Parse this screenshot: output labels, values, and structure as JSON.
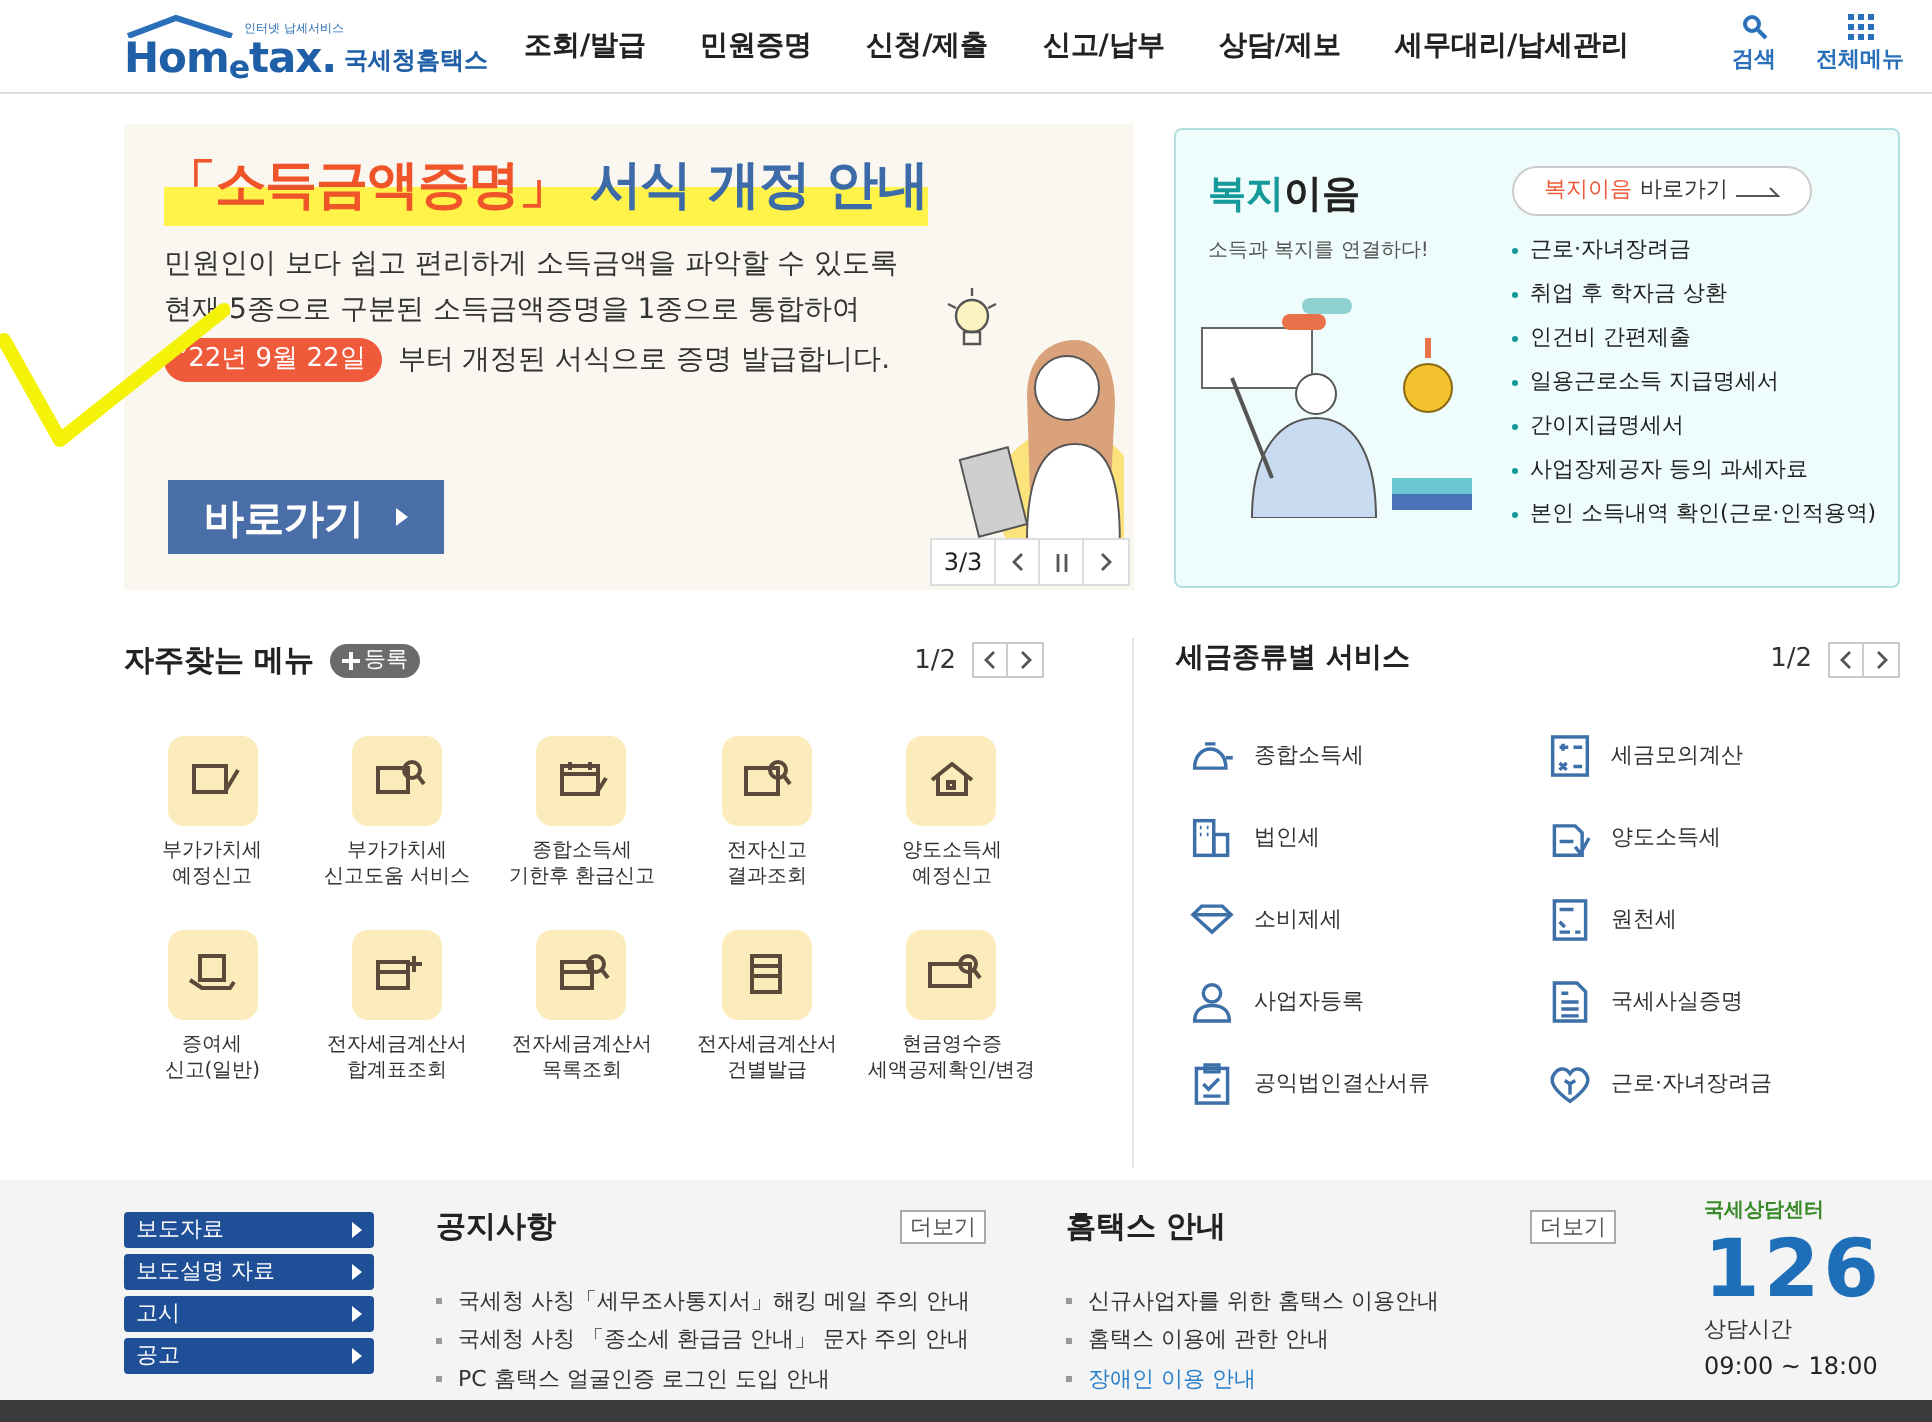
{
  "header": {
    "logo": {
      "tagline": "인터넷 납세서비스",
      "wordmark": "Hom$_{e}$tax.",
      "name": "국세청홈택스"
    },
    "nav": [
      {
        "label": "조회/발급"
      },
      {
        "label": "민원증명"
      },
      {
        "label": "신청/제출"
      },
      {
        "label": "신고/납부"
      },
      {
        "label": "상담/제보"
      },
      {
        "label": "세무대리/납세관리"
      }
    ],
    "utilities": [
      {
        "label": "검색",
        "kind": "search"
      },
      {
        "label": "전체메뉴",
        "kind": "menu"
      }
    ]
  },
  "banner": {
    "title_highlight": "「소득금액증명」",
    "title_rest": "서식 개정 안내",
    "lines": [
      "민원인이 보다 쉽고 편리하게 소득금액을 파악할 수 있도록",
      "현재 5종으로 구분된 소득금액증명을 1종으로 통합하여"
    ],
    "date_badge": "’22년 9월 22일",
    "line_rest": "부터 개정된 서식으로 증명 발급합니다.",
    "button": "바로가기",
    "pager": "3/3"
  },
  "welfare": {
    "title_a": "복지",
    "title_b": "이음",
    "subtitle": "소득과 복지를 연결하다!",
    "link_highlight": "복지이음",
    "link_rest": "바로가기",
    "items": [
      "근로·자녀장려금",
      "취업 후 학자금 상환",
      "인건비 간편제출",
      "일용근로소득 지급명세서",
      "간이지급명세서",
      "사업장제공자 등의 과세자료",
      "본인 소득내역 확인(근로·인적용역)"
    ]
  },
  "favorites": {
    "title": "자주찾는 메뉴",
    "add_button": "등록",
    "pager": "1/2",
    "items": [
      {
        "lines": [
          "부가가치세",
          "예정신고"
        ]
      },
      {
        "lines": [
          "부가가치세",
          "신고도움 서비스"
        ]
      },
      {
        "lines": [
          "종합소득세",
          "기한후 환급신고"
        ]
      },
      {
        "lines": [
          "전자신고",
          "결과조회"
        ]
      },
      {
        "lines": [
          "양도소득세",
          "예정신고"
        ]
      },
      {
        "lines": [
          "증여세",
          "신고(일반)"
        ]
      },
      {
        "lines": [
          "전자세금계산서",
          "합계표조회"
        ]
      },
      {
        "lines": [
          "전자세금계산서",
          "목록조회"
        ]
      },
      {
        "lines": [
          "전자세금계산서",
          "건별발급"
        ]
      },
      {
        "lines": [
          "현금영수증",
          "세액공제확인/변경"
        ]
      }
    ]
  },
  "tax_services": {
    "title": "세금종류별 서비스",
    "pager": "1/2",
    "items": [
      "종합소득세",
      "세금모의계산",
      "법인세",
      "양도소득세",
      "소비제세",
      "원천세",
      "사업자등록",
      "국세사실증명",
      "공익법인결산서류",
      "근로·자녀장려금"
    ]
  },
  "footer": {
    "side_menu": [
      "보도자료",
      "보도설명 자료",
      "고시",
      "공고"
    ],
    "notices": {
      "title": "공지사항",
      "more": "더보기",
      "items": [
        {
          "text": "국세청 사칭「세무조사통지서」해킹 메일 주의 안내",
          "highlighted": false
        },
        {
          "text": "국세청 사칭 「종소세 환급금 안내」 문자 주의 안내",
          "highlighted": false
        },
        {
          "text": "PC 홈택스 얼굴인증 로그인 도입 안내",
          "highlighted": false
        }
      ]
    },
    "guide": {
      "title": "홈택스 안내",
      "more": "더보기",
      "items": [
        {
          "text": "신규사업자를 위한 홈택스 이용안내",
          "highlighted": false
        },
        {
          "text": "홈택스 이용에 관한 안내",
          "highlighted": false
        },
        {
          "text": "장애인 이용 안내",
          "highlighted": true
        }
      ]
    },
    "call_center": {
      "label": "국세상담센터",
      "number": "126",
      "hours_label": "상담시간",
      "hours": "09:00 ~ 18:00"
    }
  }
}
